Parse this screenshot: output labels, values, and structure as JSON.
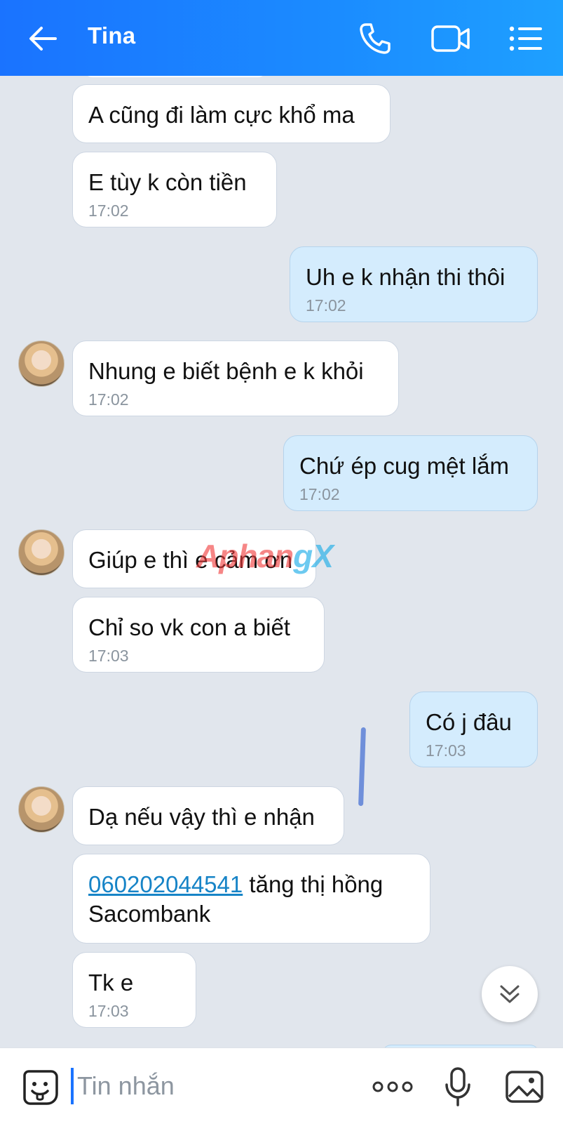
{
  "header": {
    "contact_name": "Tina",
    "icons": [
      "back-arrow-icon",
      "phone-icon",
      "video-camera-icon",
      "list-menu-icon"
    ]
  },
  "messages": [
    {
      "dir": "in",
      "text": "A cũng đi làm cực khổ ma"
    },
    {
      "dir": "in",
      "text": "E tùy k còn tiền",
      "time": "17:02"
    },
    {
      "dir": "out",
      "text": "Uh e k nhận thi thôi",
      "time": "17:02"
    },
    {
      "dir": "in",
      "text": "Nhung e biết bệnh e k khỏi",
      "time": "17:02"
    },
    {
      "dir": "out",
      "text": "Chứ ép cug mệt lắm",
      "time": "17:02"
    },
    {
      "dir": "in",
      "text": "Giúp e thì e cảm ơn"
    },
    {
      "dir": "in",
      "text": "Chỉ so vk con a biết",
      "time": "17:03"
    },
    {
      "dir": "out",
      "text": "Có j đâu",
      "time": "17:03"
    },
    {
      "dir": "in",
      "text": "Dạ nếu vậy thì e nhận"
    },
    {
      "dir": "in",
      "account": "060202044541",
      "text_after": " tăng thị hồng",
      "text_line2": "Sacombank"
    },
    {
      "dir": "in",
      "text": "Tk e",
      "time": "17:03"
    }
  ],
  "watermark": {
    "part1": "Aphan",
    "part2": "gX"
  },
  "input": {
    "placeholder": "Tin nhắn"
  },
  "colors": {
    "header": "#1a73ff",
    "outgoing_bubble": "#d4ecfd",
    "incoming_bubble": "#ffffff",
    "background": "#e1e6ed",
    "link": "#1784c7"
  }
}
